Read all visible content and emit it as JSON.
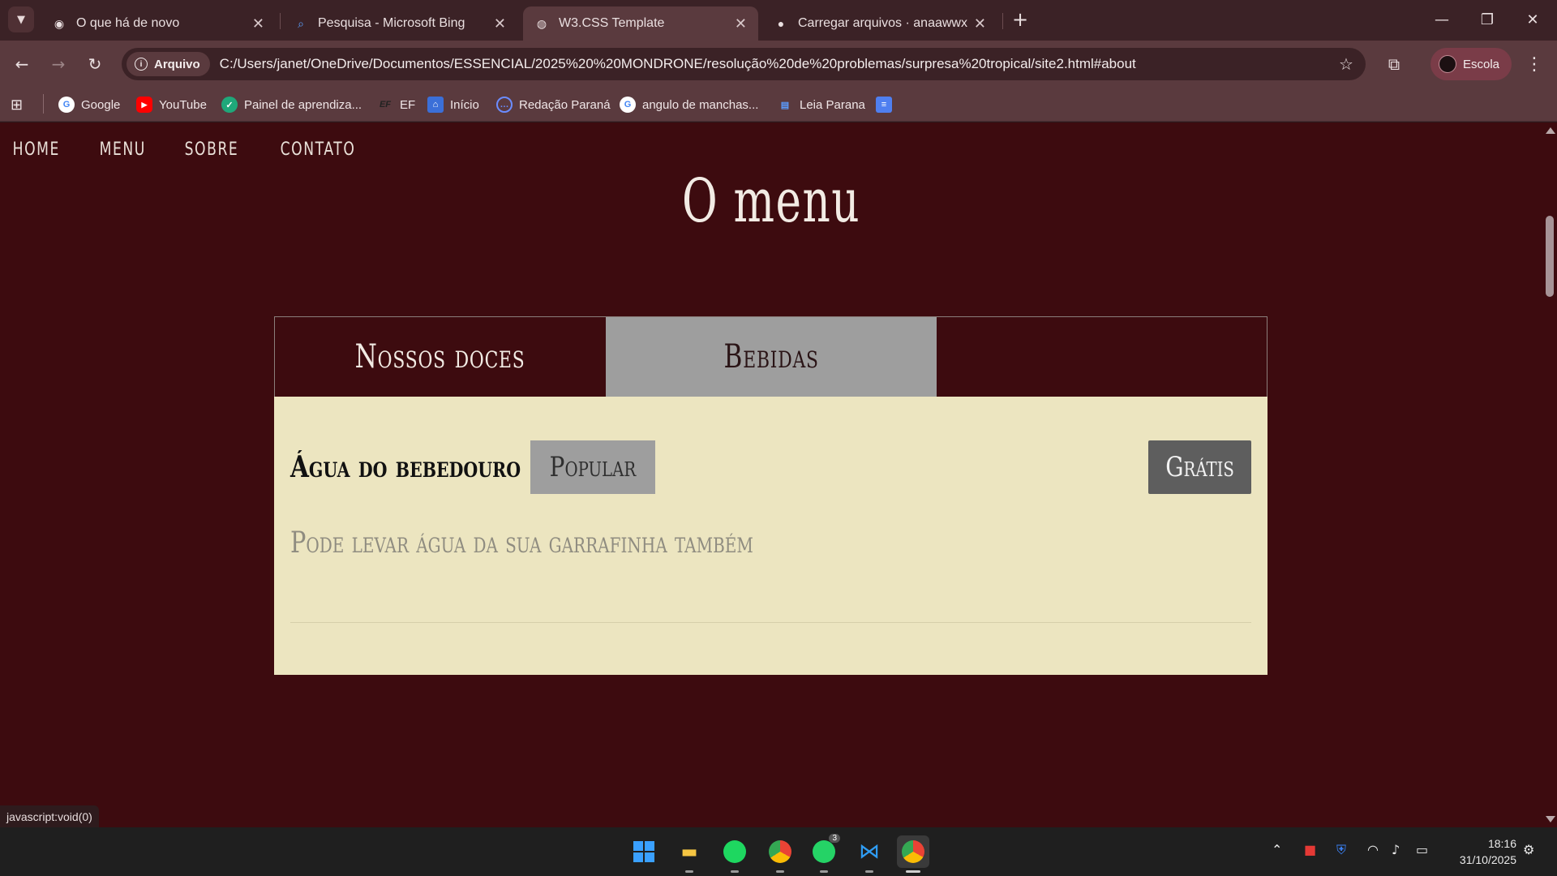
{
  "browser": {
    "tabs": [
      {
        "title": "O que há de novo",
        "icon": "chrome-icon",
        "active": false
      },
      {
        "title": "Pesquisa - Microsoft Bing",
        "icon": "search-icon",
        "active": false
      },
      {
        "title": "W3.CSS Template",
        "icon": "globe-icon",
        "active": true
      },
      {
        "title": "Carregar arquivos · anaawwx/tr",
        "icon": "github-icon",
        "active": false
      }
    ],
    "address": {
      "security_chip": "Arquivo",
      "url": "C:/Users/janet/OneDrive/Documentos/ESSENCIAL/2025%20%20MONDRONE/resolução%20de%20problemas/surpresa%20tropical/site2.html#about"
    },
    "profile_name": "Escola",
    "bookmarks": [
      {
        "label": "Google",
        "icon": "google-icon"
      },
      {
        "label": "YouTube",
        "icon": "youtube-icon"
      },
      {
        "label": "Painel de aprendiza...",
        "icon": "learning-icon"
      },
      {
        "label": "EF",
        "icon": "ef-icon"
      },
      {
        "label": "Início",
        "icon": "home-icon"
      },
      {
        "label": "Redação Paraná",
        "icon": "chat-icon"
      },
      {
        "label": "angulo de manchas...",
        "icon": "google-icon"
      },
      {
        "label": "Leia Parana",
        "icon": "books-icon"
      }
    ],
    "status_link": "javascript:void(0)"
  },
  "page": {
    "nav": [
      "HOME",
      "MENU",
      "SOBRE",
      "CONTATO"
    ],
    "title": "O menu",
    "menu_tabs": [
      {
        "label": "Nossos doces",
        "active": false
      },
      {
        "label": "Bebidas",
        "active": true
      }
    ],
    "item": {
      "name": "Água do bebedouro",
      "tag": "Popular",
      "price": "Grátis",
      "description": "Pode levar água da sua garrafinha também"
    }
  },
  "taskbar": {
    "time": "18:16",
    "date": "31/10/2025",
    "whatsapp_badge": "3"
  },
  "colors": {
    "page_background": "#3d0b0f",
    "panel_background": "#ece5c0",
    "active_tab": "#9e9e9e",
    "price_badge": "#5e5e5e"
  }
}
